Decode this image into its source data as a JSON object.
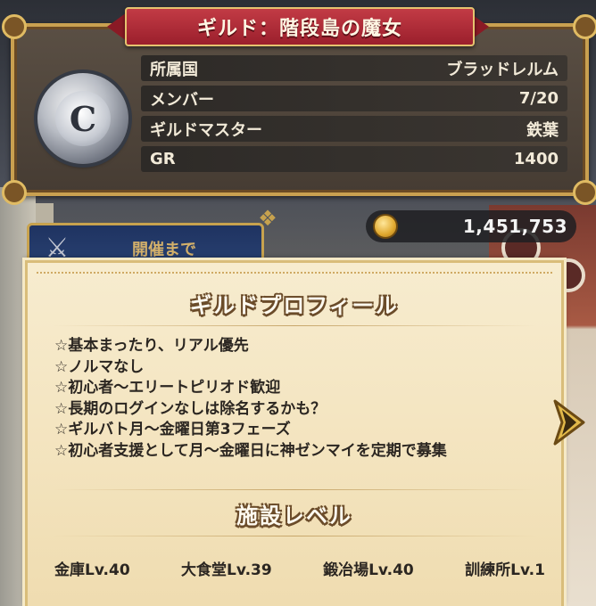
{
  "guild": {
    "title": "ギルド：階段島の魔女",
    "emblem_letter": "C",
    "rows": [
      {
        "label": "所属国",
        "value": "ブラッドレルム"
      },
      {
        "label": "メンバー",
        "value": "7/20"
      },
      {
        "label": "ギルドマスター",
        "value": "鉄葉"
      },
      {
        "label": "GR",
        "value": "1400"
      }
    ]
  },
  "currency": {
    "icon": "gold-coin-icon",
    "amount": "1,451,753"
  },
  "background": {
    "banner_text": "開催まで"
  },
  "profile": {
    "title": "ギルドプロフィール",
    "lines": [
      "☆基本まったり、リアル優先",
      "☆ノルマなし",
      "☆初心者〜エリートピリオド歓迎",
      "☆長期のログインなしは除名するかも？",
      "☆ギルバト月〜金曜日第3フェーズ",
      "☆初心者支援として月〜金曜日に神ゼンマイを定期で募集"
    ]
  },
  "facilities": {
    "title": "施設レベル",
    "items": [
      {
        "label": "金庫Lv.40"
      },
      {
        "label": "大食堂Lv.39"
      },
      {
        "label": "鍛冶場Lv.40"
      },
      {
        "label": "訓練所Lv.1"
      }
    ]
  },
  "colors": {
    "panel_border": "#c9a050",
    "ribbon": "#c23b45",
    "parchment": "#f3e3bd",
    "arrow": "#e2b94a"
  }
}
